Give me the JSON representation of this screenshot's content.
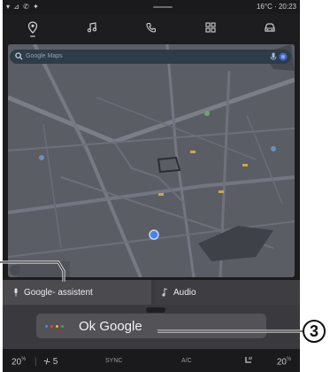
{
  "status_bar": {
    "signal_icons": "▾ ⊿ ✆ ✦",
    "temp_time": "16°C · 20:23"
  },
  "nav_items": [
    "navigation-icon",
    "music-icon",
    "phone-icon",
    "apps-icon",
    "car-icon"
  ],
  "search": {
    "placeholder": "Google Maps"
  },
  "assistant_button": {
    "label": "Google- assistent"
  },
  "audio_button": {
    "label": "Audio"
  },
  "ok_google": {
    "text": "Ok Google",
    "dot_colors": [
      "#4285f4",
      "#ea4335",
      "#fbbc05",
      "#34a853"
    ]
  },
  "climate": {
    "temp_left": "20",
    "temp_left_half": "½",
    "fan_speed": "5",
    "sync_label": "SYNC",
    "ac_label": "A/C",
    "temp_right": "20",
    "temp_right_half": "½"
  },
  "callouts": {
    "number_3": "3"
  },
  "colors": {
    "accent_blue": "#4285f4",
    "map_road": "#7d8089",
    "screen_bg": "#1c1c1f"
  }
}
